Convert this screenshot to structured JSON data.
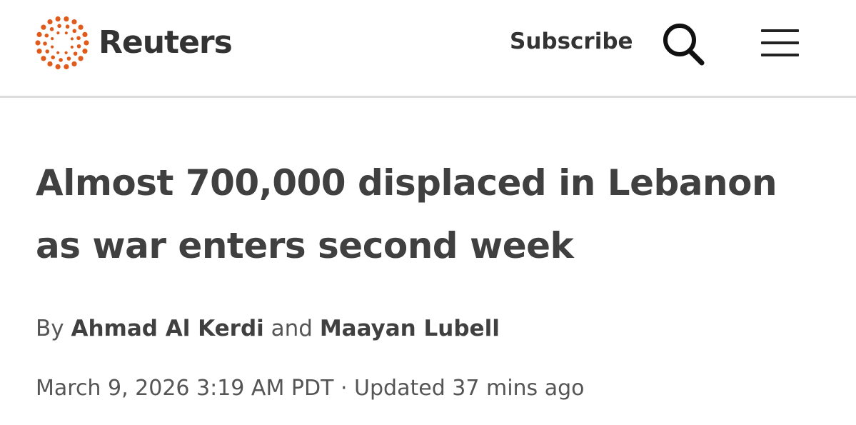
{
  "header": {
    "brand_name": "Reuters",
    "subscribe_label": "Subscribe",
    "search_icon": "search-icon",
    "menu_icon": "hamburger-menu-icon",
    "brand_color": "#e05a1c"
  },
  "article": {
    "headline": "Almost 700,000 displaced in Lebanon as war enters second week",
    "byline": {
      "prefix": "By",
      "author_1": "Ahmad Al Kerdi",
      "conjunction": "and",
      "author_2": "Maayan Lubell"
    },
    "date": "March 9, 2026 3:19 AM PDT",
    "separator": "·",
    "updated": "Updated 37 mins ago"
  }
}
